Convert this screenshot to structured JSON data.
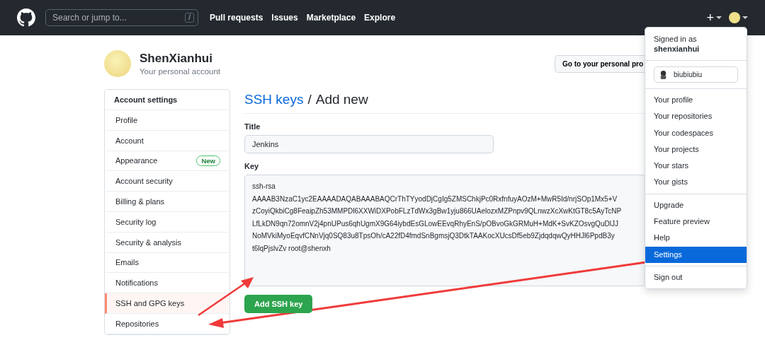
{
  "header": {
    "search": {
      "placeholder": "Search or jump to...",
      "shortcut": "/"
    },
    "nav": [
      "Pull requests",
      "Issues",
      "Marketplace",
      "Explore"
    ],
    "new_button": "+"
  },
  "account": {
    "name": "ShenXianhui",
    "subtitle": "Your personal account",
    "profile_button": "Go to your personal pro"
  },
  "sidebar": {
    "heading": "Account settings",
    "items": [
      {
        "label": "Profile",
        "selected": false
      },
      {
        "label": "Account",
        "selected": false
      },
      {
        "label": "Appearance",
        "selected": false,
        "badge": "New"
      },
      {
        "label": "Account security",
        "selected": false
      },
      {
        "label": "Billing & plans",
        "selected": false
      },
      {
        "label": "Security log",
        "selected": false
      },
      {
        "label": "Security & analysis",
        "selected": false
      },
      {
        "label": "Emails",
        "selected": false
      },
      {
        "label": "Notifications",
        "selected": false
      },
      {
        "label": "SSH and GPG keys",
        "selected": true
      },
      {
        "label": "Repositories",
        "selected": false
      }
    ]
  },
  "page": {
    "breadcrumb": "SSH keys",
    "separator": "/",
    "title": "Add new"
  },
  "form": {
    "title_label": "Title",
    "title_value": "Jenkins",
    "key_label": "Key",
    "key_lines": [
      "ssh-rsa",
      "AAAAB3NzaC1yc2EAAAADAQABAAABAQCrThTYyodDjCgIg5ZMSChkjPc0RxfnfuyAOzM+MwR5Id/nrjSOp1Mx5+V",
      "zCoyiQkbiCg8FeaipZh53MMPDl6XXWiDXPobFLzTdWx3gBw1yju866UAelozxMZPnpv9QLnwzXcXwKtGT8c5AyTcNP",
      "LfLkDN9qn72omnV2j4pnUPus6qhUgmX9G64iybdEsGLowEEvqRhyEnS/pOBvoGkGRMuH+MdK+SvKZOsvgQuDlJJ",
      "NoMVkiMyoEqvfCNnVjq0SQ83u8TpsOh/cA22fD4fmdSnBgmsjQ3DtkTAAKocXUcsDf5eb9ZjdqdqwQyHHJl6PpdB3y",
      "t6lqPjslvZv root@shenxh"
    ],
    "submit": "Add SSH key"
  },
  "menu": {
    "signed_in_as": "Signed in as",
    "username": "shenxianhui",
    "status": "biubiubiu",
    "groups": [
      [
        {
          "label": "Your profile",
          "selected": false
        },
        {
          "label": "Your repositories",
          "selected": false
        },
        {
          "label": "Your codespaces",
          "selected": false
        },
        {
          "label": "Your projects",
          "selected": false
        },
        {
          "label": "Your stars",
          "selected": false
        },
        {
          "label": "Your gists",
          "selected": false
        }
      ],
      [
        {
          "label": "Upgrade",
          "selected": false
        },
        {
          "label": "Feature preview",
          "selected": false
        },
        {
          "label": "Help",
          "selected": false
        },
        {
          "label": "Settings",
          "selected": true
        }
      ],
      [
        {
          "label": "Sign out",
          "selected": false
        }
      ]
    ]
  }
}
